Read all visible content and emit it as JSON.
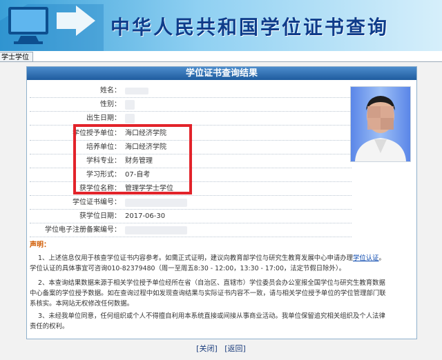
{
  "header": {
    "site_title": "中华人民共和国学位证书查询"
  },
  "tab": {
    "label": "学士学位"
  },
  "card": {
    "title": "学位证书查询结果"
  },
  "fields": [
    {
      "label": "姓名：",
      "value": ""
    },
    {
      "label": "性别：",
      "value": ""
    },
    {
      "label": "出生日期：",
      "value": ""
    },
    {
      "label": "学位授予单位：",
      "value": "海口经济学院"
    },
    {
      "label": "培养单位：",
      "value": "海口经济学院"
    },
    {
      "label": "学科专业：",
      "value": "财务管理"
    },
    {
      "label": "学习形式：",
      "value": "07-自考"
    },
    {
      "label": "获学位名称：",
      "value": "管理学学士学位"
    },
    {
      "label": "学位证书编号：",
      "value": ""
    },
    {
      "label": "获学位日期：",
      "value": "2017-06-30"
    },
    {
      "label": "学位电子注册备案编号：",
      "value": ""
    }
  ],
  "notice": {
    "title": "声明：",
    "p1_a": "1、上述信息仅用于核查学位证书内容参考。如需正式证明，建议向教育部学位与研究生教育发展中心申请办理",
    "p1_link": "学位认证",
    "p1_b": "。",
    "p1_c": "学位认证的具体事宜可咨询010-82379480（周一至周五8:30 - 12:00，13:30 - 17:00，法定节假日除外）。",
    "p2": "2、本查询结果数据来源于相关学位授予单位经所在省（自治区、直辖市）学位委员会办公室报全国学位与研究生教育数据中心备案的学位授予数据。如在查询过程中如发现查询结果与实际证书内容不一致，请与相关学位授予单位的学位管理部门联系核实。本网站无权修改任何数据。",
    "p3": "3、未经我单位同意，任何组织或个人不得擅自利用本系统直接或间接从事商业活动。我单位保留追究相关组织及个人法律责任的权利。"
  },
  "footer": {
    "close_label": "[关闭]",
    "back_label": "[返回]"
  },
  "colors": {
    "title_blue": "#0f3c8a",
    "bar_blue": "#1f5c9e",
    "highlight_red": "#e2232a",
    "notice_orange": "#d05a00"
  },
  "icons": {
    "header": "computer-monitor-arrow-icon",
    "photo": "id-photo"
  }
}
